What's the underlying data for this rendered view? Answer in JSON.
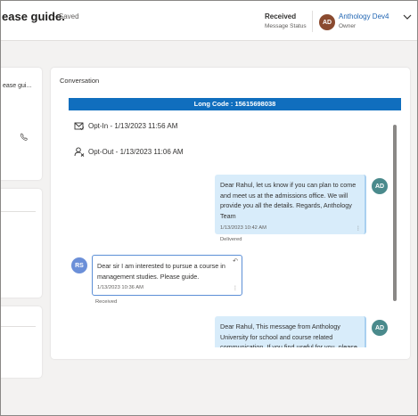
{
  "header": {
    "record_title": "ease guide.",
    "saved_text": "- Saved",
    "message_status_value": "Received",
    "message_status_label": "Message Status",
    "owner_initials": "AD",
    "owner_name": "Anthology Dev4",
    "owner_label": "Owner"
  },
  "left_panel": {
    "subject_snippet": "ease gui..."
  },
  "conversation": {
    "title": "Conversation",
    "long_code_banner": "Long Code : 15615698038",
    "events": [
      {
        "icon": "opt-in-icon",
        "text": "Opt-In - 1/13/2023 11:56 AM"
      },
      {
        "icon": "opt-out-icon",
        "text": "Opt-Out - 1/13/2023 11:06 AM"
      }
    ],
    "messages": [
      {
        "direction": "outgoing",
        "avatar": "AD",
        "text": "Dear Rahul, let us know if you can plan to come and meet us at the admissions office. We will provide you all the details. Regards, Anthology Team",
        "time": "1/13/2023 10:42 AM",
        "status": "Delivered"
      },
      {
        "direction": "incoming",
        "avatar": "RS",
        "text": "Dear sir I am interested to pursue a course in management studies. Please guide.",
        "time": "1/13/2023 10:36 AM",
        "status": "Received"
      },
      {
        "direction": "outgoing",
        "avatar": "AD",
        "text": "Dear Rahul, This message from Anthology University for school and course related communication. If you find useful for you, please reply SMS 'Y' to get notifications."
      }
    ]
  },
  "colors": {
    "banner": "#106ebe",
    "outgoing_bubble": "#d8ecfa",
    "incoming_border": "#5c8fd6",
    "avatar_ad": "#4a8a8c",
    "avatar_rs": "#6b8fd8",
    "owner_avatar": "#8a4a2f",
    "owner_link": "#2266b3"
  }
}
